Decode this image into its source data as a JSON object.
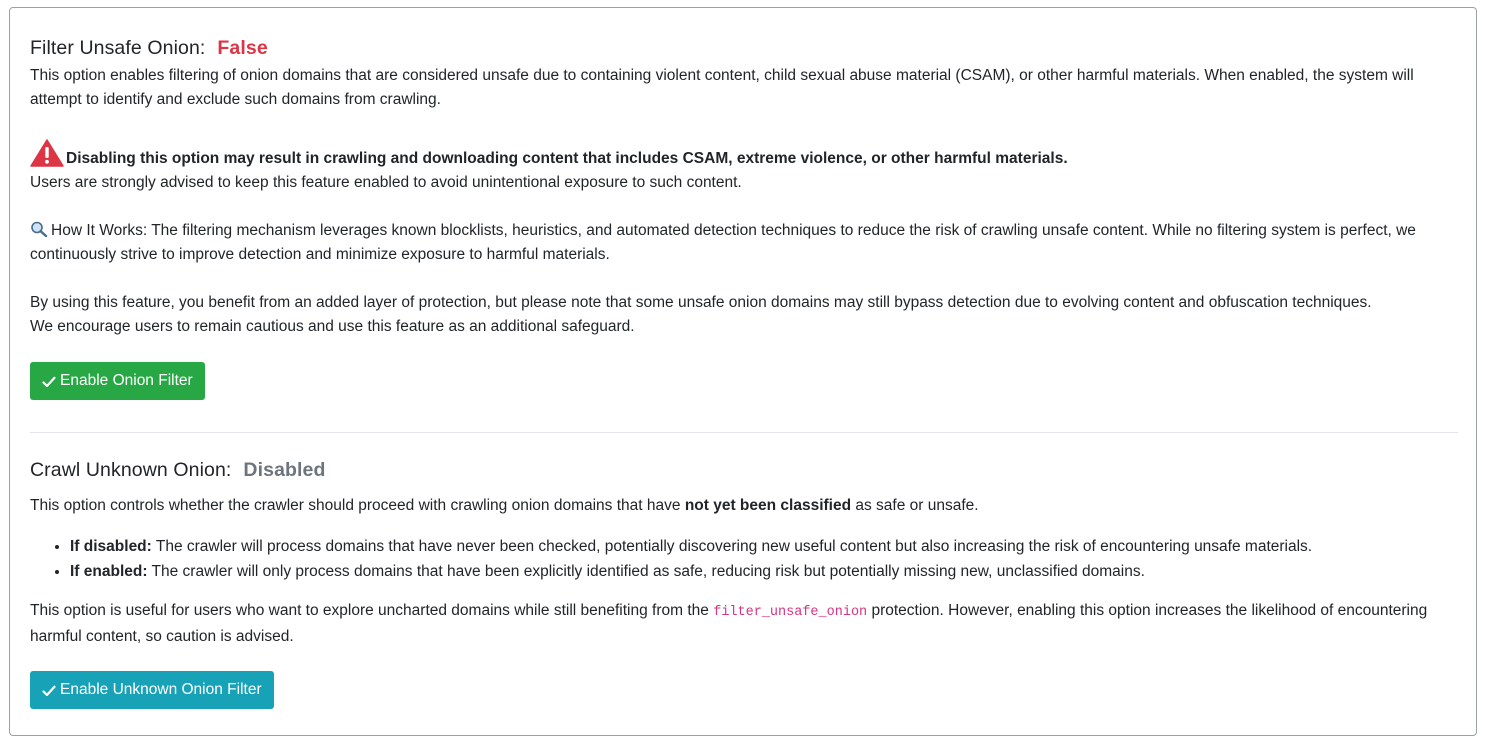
{
  "unsafe_section": {
    "title": "Filter Unsafe Onion:",
    "status": "False",
    "description": "This option enables filtering of onion domains that are considered unsafe due to containing violent content, child sexual abuse material (CSAM), or other harmful materials. When enabled, the system will attempt to identify and exclude such domains from crawling.",
    "warning_bold": "Disabling this option may result in crawling and downloading content that includes CSAM, extreme violence, or other harmful materials.",
    "warning_text": "Users are strongly advised to keep this feature enabled to avoid unintentional exposure to such content.",
    "how_it_works_icon": "magnifying-glass-icon",
    "how_it_works": "How It Works: The filtering mechanism leverages known blocklists, heuristics, and automated detection techniques to reduce the risk of crawling unsafe content. While no filtering system is perfect, we continuously strive to improve detection and minimize exposure to harmful materials.",
    "protection_line1": "By using this feature, you benefit from an added layer of protection, but please note that some unsafe onion domains may still bypass detection due to evolving content and obfuscation techniques.",
    "protection_line2": "We encourage users to remain cautious and use this feature as an additional safeguard.",
    "button_label": "Enable Onion Filter"
  },
  "unknown_section": {
    "title": "Crawl Unknown Onion:",
    "status": "Disabled",
    "description_pre": "This option controls whether the crawler should proceed with crawling onion domains that have ",
    "description_bold": "not yet been classified",
    "description_post": " as safe or unsafe.",
    "bullets": [
      {
        "bold": "If disabled:",
        "text": " The crawler will process domains that have never been checked, potentially discovering new useful content but also increasing the risk of encountering unsafe materials."
      },
      {
        "bold": "If enabled:",
        "text": " The crawler will only process domains that have been explicitly identified as safe, reducing risk but potentially missing new, unclassified domains."
      }
    ],
    "note_pre": "This option is useful for users who want to explore uncharted domains while still benefiting from the ",
    "note_code": "filter_unsafe_onion",
    "note_post": " protection. However, enabling this option increases the likelihood of encountering harmful content, so caution is advised.",
    "button_label": "Enable Unknown Onion Filter"
  },
  "colors": {
    "danger": "#dc3545",
    "muted": "#6c757d",
    "success": "#28a745",
    "info": "#17a2b8",
    "code": "#d63384"
  }
}
